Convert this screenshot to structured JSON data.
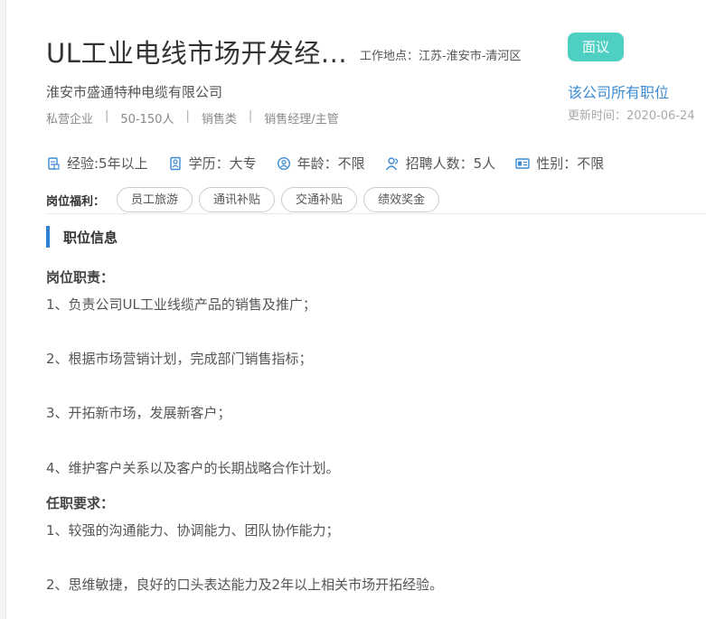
{
  "job": {
    "title": "UL工业电线市场开发经...",
    "location": "工作地点：江苏-淮安市-清河区",
    "salary_label": "面议",
    "company": "淮安市盛通特种电缆有限公司",
    "all_jobs_link": "该公司所有职位",
    "meta": [
      "私营企业",
      "50-150人",
      "销售类",
      "销售经理/主管"
    ],
    "meta_separator": "|",
    "updated": "更新时间：2020-06-24"
  },
  "requirements": [
    {
      "icon": "experience-icon",
      "text": "经验:5年以上"
    },
    {
      "icon": "education-icon",
      "text": "学历：大专"
    },
    {
      "icon": "age-icon",
      "text": "年龄：不限"
    },
    {
      "icon": "headcount-icon",
      "text": "招聘人数：5人"
    },
    {
      "icon": "gender-icon",
      "text": "性别：不限"
    }
  ],
  "benefits": {
    "label": "岗位福利：",
    "tags": [
      "员工旅游",
      "通讯补贴",
      "交通补贴",
      "绩效奖金"
    ]
  },
  "section": {
    "title": "职位信息",
    "duties_title": "岗位职责：",
    "duties": [
      "1、负责公司UL工业线缆产品的销售及推广；",
      "2、根据市场营销计划，完成部门销售指标；",
      "3、开拓新市场，发展新客户；",
      "4、维护客户关系以及客户的长期战略合作计划。"
    ],
    "reqs_title": "任职要求：",
    "reqs": [
      "1、较强的沟通能力、协调能力、团队协作能力；",
      "2、思维敏捷，良好的口头表达能力及2年以上相关市场开拓经验。"
    ]
  },
  "colors": {
    "accent_teal": "#4fcfc1",
    "link_blue": "#3b8ad3",
    "section_bar": "#2f7fd1",
    "icon_blue": "#3b8ad3"
  }
}
